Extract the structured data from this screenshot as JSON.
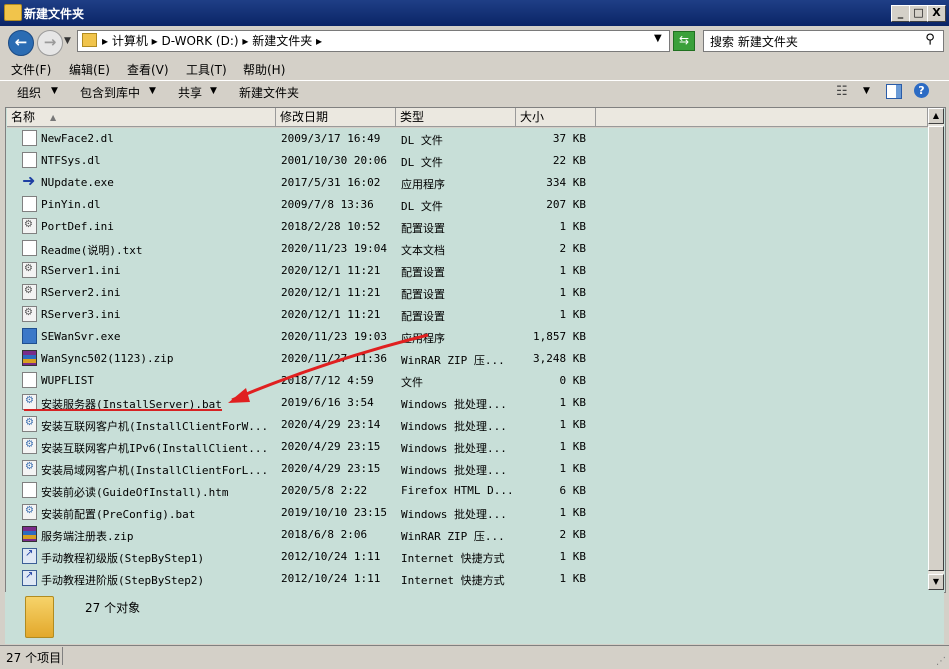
{
  "window": {
    "title": "新建文件夹",
    "min_glyph": "_",
    "max_glyph": "□",
    "close_glyph": "X"
  },
  "address": {
    "path": "▸ 计算机 ▸ D-WORK (D:) ▸ 新建文件夹 ▸",
    "search_placeholder": "搜索 新建文件夹"
  },
  "menu": [
    "文件(F)",
    "编辑(E)",
    "查看(V)",
    "工具(T)",
    "帮助(H)"
  ],
  "toolbar": {
    "organize": "组织",
    "include": "包含到库中",
    "share": "共享",
    "new_folder": "新建文件夹"
  },
  "columns": {
    "name": "名称",
    "date": "修改日期",
    "type": "类型",
    "size": "大小"
  },
  "files": [
    {
      "name": "NewFace2.dl",
      "date": "2009/3/17 16:49",
      "type": "DL 文件",
      "size": "37 KB",
      "icon": "doc"
    },
    {
      "name": "NTFSys.dl",
      "date": "2001/10/30 20:06",
      "type": "DL 文件",
      "size": "22 KB",
      "icon": "doc"
    },
    {
      "name": "NUpdate.exe",
      "date": "2017/5/31 16:02",
      "type": "应用程序",
      "size": "334 KB",
      "icon": "arrow"
    },
    {
      "name": "PinYin.dl",
      "date": "2009/7/8 13:36",
      "type": "DL 文件",
      "size": "207 KB",
      "icon": "doc"
    },
    {
      "name": "PortDef.ini",
      "date": "2018/2/28 10:52",
      "type": "配置设置",
      "size": "1 KB",
      "icon": "cfg"
    },
    {
      "name": "Readme(说明).txt",
      "date": "2020/11/23 19:04",
      "type": "文本文档",
      "size": "2 KB",
      "icon": "doc"
    },
    {
      "name": "RServer1.ini",
      "date": "2020/12/1 11:21",
      "type": "配置设置",
      "size": "1 KB",
      "icon": "cfg"
    },
    {
      "name": "RServer2.ini",
      "date": "2020/12/1 11:21",
      "type": "配置设置",
      "size": "1 KB",
      "icon": "cfg"
    },
    {
      "name": "RServer3.ini",
      "date": "2020/12/1 11:21",
      "type": "配置设置",
      "size": "1 KB",
      "icon": "cfg"
    },
    {
      "name": "SEWanSvr.exe",
      "date": "2020/11/23 19:03",
      "type": "应用程序",
      "size": "1,857 KB",
      "icon": "app"
    },
    {
      "name": "WanSync502(1123).zip",
      "date": "2020/11/27 11:36",
      "type": "WinRAR ZIP 压...",
      "size": "3,248 KB",
      "icon": "rar"
    },
    {
      "name": "WUPFLIST",
      "date": "2018/7/12 4:59",
      "type": "文件",
      "size": "0 KB",
      "icon": "doc"
    },
    {
      "name": "安装服务器(InstallServer).bat",
      "date": "2019/6/16 3:54",
      "type": "Windows 批处理...",
      "size": "1 KB",
      "icon": "bat"
    },
    {
      "name": "安装互联网客户机(InstallClientForW...",
      "date": "2020/4/29 23:14",
      "type": "Windows 批处理...",
      "size": "1 KB",
      "icon": "bat"
    },
    {
      "name": "安装互联网客户机IPv6(InstallClient...",
      "date": "2020/4/29 23:15",
      "type": "Windows 批处理...",
      "size": "1 KB",
      "icon": "bat"
    },
    {
      "name": "安装局域网客户机(InstallClientForL...",
      "date": "2020/4/29 23:15",
      "type": "Windows 批处理...",
      "size": "1 KB",
      "icon": "bat"
    },
    {
      "name": "安装前必读(GuideOfInstall).htm",
      "date": "2020/5/8 2:22",
      "type": "Firefox HTML D...",
      "size": "6 KB",
      "icon": "htm"
    },
    {
      "name": "安装前配置(PreConfig).bat",
      "date": "2019/10/10 23:15",
      "type": "Windows 批处理...",
      "size": "1 KB",
      "icon": "bat"
    },
    {
      "name": "服务端注册表.zip",
      "date": "2018/6/8 2:06",
      "type": "WinRAR ZIP 压...",
      "size": "2 KB",
      "icon": "rar"
    },
    {
      "name": "手动教程初级版(StepByStep1)",
      "date": "2012/10/24 1:11",
      "type": "Internet 快捷方式",
      "size": "1 KB",
      "icon": "lnk"
    },
    {
      "name": "手动教程进阶版(StepByStep2)",
      "date": "2012/10/24 1:11",
      "type": "Internet 快捷方式",
      "size": "1 KB",
      "icon": "lnk"
    }
  ],
  "details": {
    "count": "27 个对象"
  },
  "status": {
    "text": "27 个项目"
  },
  "colors": {
    "list_bg": "#c8dfd8",
    "annotation": "#d62222"
  }
}
